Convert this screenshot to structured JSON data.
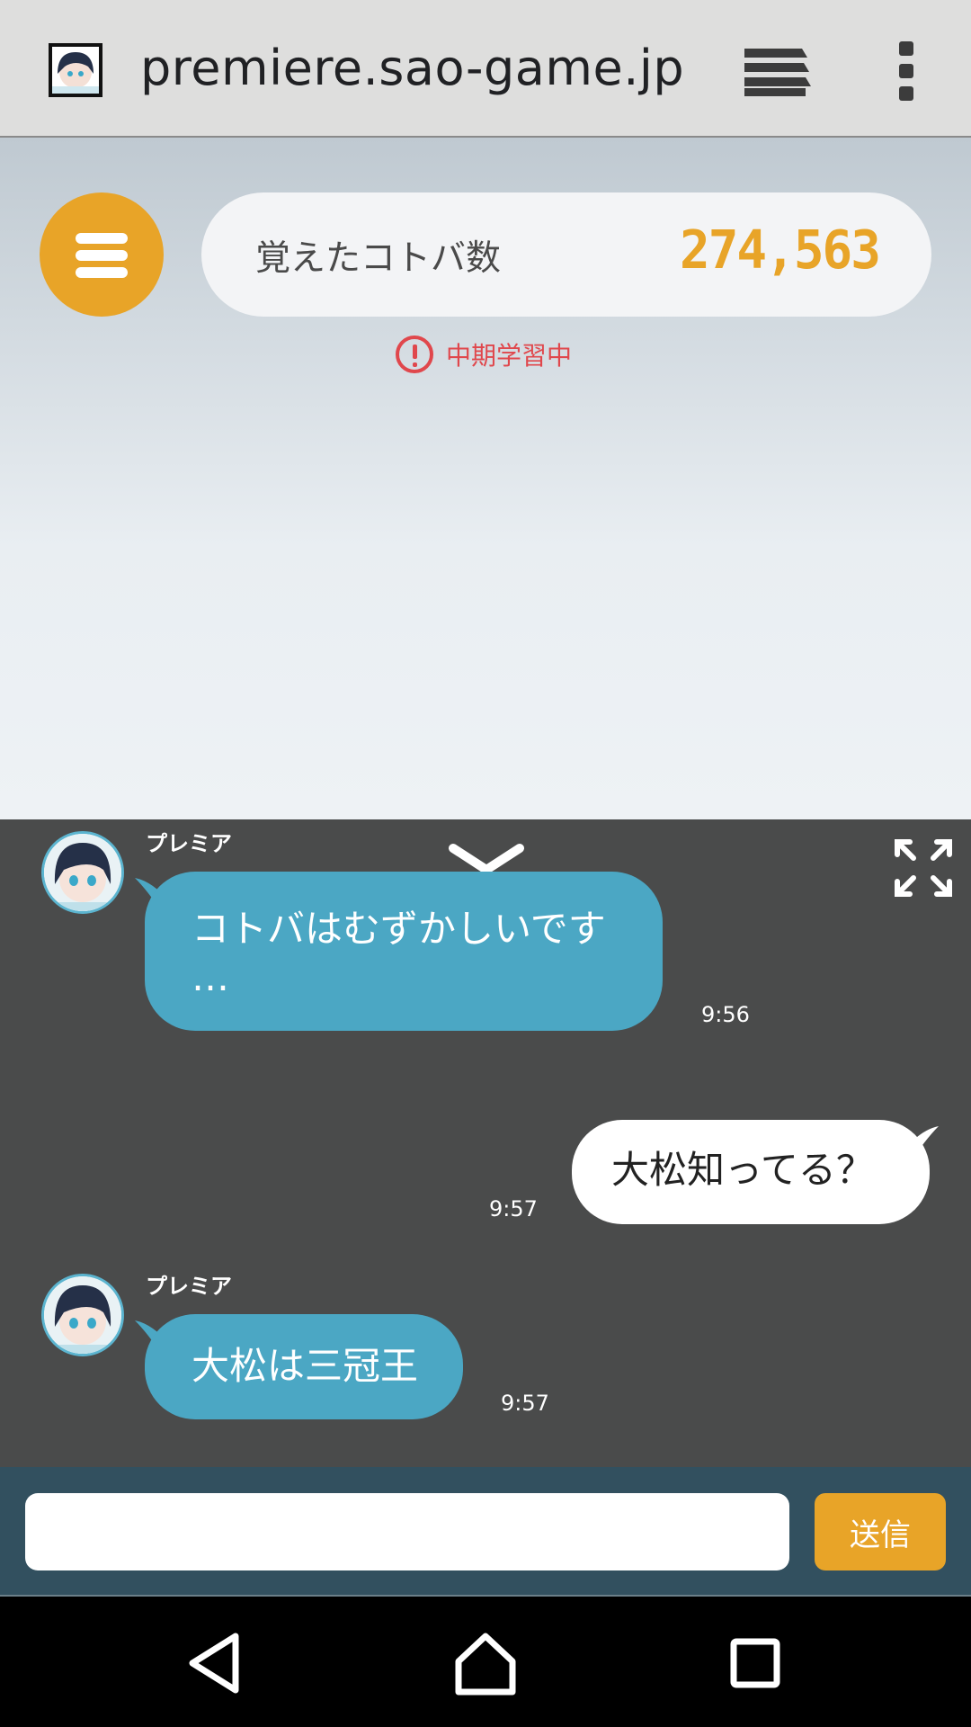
{
  "browser": {
    "url": "premiere.sao-game.jp",
    "favicon": "avatar-favicon",
    "tabs_icon": "tabs-icon",
    "menu_icon": "kebab-icon"
  },
  "header": {
    "menu_icon": "hamburger-icon",
    "word_label": "覚えたコトバ数",
    "word_count": "274,563",
    "status": "中期学習中",
    "status_icon": "alert-icon"
  },
  "chat": {
    "messages": [
      {
        "sender": "プレミア",
        "side": "bot",
        "text_line1": "コトバはむずかしいです",
        "text_line2": "…",
        "time": "9:56"
      },
      {
        "sender": "",
        "side": "user",
        "text": "大松知ってる？",
        "time": "9:57"
      },
      {
        "sender": "プレミア",
        "side": "bot",
        "text": "大松は三冠王",
        "time": "9:57"
      }
    ]
  },
  "input": {
    "placeholder": "",
    "value": "",
    "send_label": "送信"
  },
  "colors": {
    "accent": "#e8a428",
    "bot_bubble": "#4ba7c4",
    "chat_bg": "#4a4b4b",
    "input_bar": "#32505f",
    "alert": "#e0474c"
  }
}
